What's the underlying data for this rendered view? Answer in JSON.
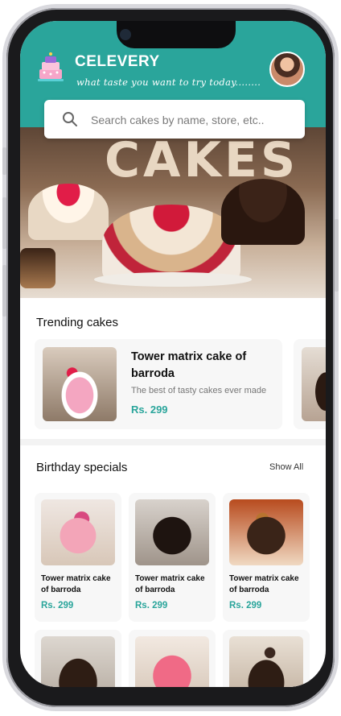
{
  "app": {
    "brand": "CELEVERY",
    "tagline": "what taste you want to try today........",
    "logo_icon": "cake-logo-icon",
    "avatar_icon": "user-avatar"
  },
  "search": {
    "placeholder": "Search cakes by name, store, etc..",
    "icon": "search-icon"
  },
  "hero": {
    "title": "CAKES"
  },
  "trending": {
    "title": "Trending cakes",
    "items": [
      {
        "name": "Tower matrix cake of barroda",
        "description": "The best of tasty cakes ever made",
        "price": "Rs. 299"
      }
    ]
  },
  "birthday": {
    "title": "Birthday specials",
    "show_all": "Show All",
    "items": [
      {
        "name": "Tower matrix cake of barroda",
        "price": "Rs. 299"
      },
      {
        "name": "Tower matrix cake of barroda",
        "price": "Rs. 299"
      },
      {
        "name": "Tower matrix cake of barroda",
        "price": "Rs. 299"
      }
    ]
  },
  "colors": {
    "accent": "#2aa59b",
    "card_bg": "#f7f7f7",
    "text": "#111111"
  }
}
